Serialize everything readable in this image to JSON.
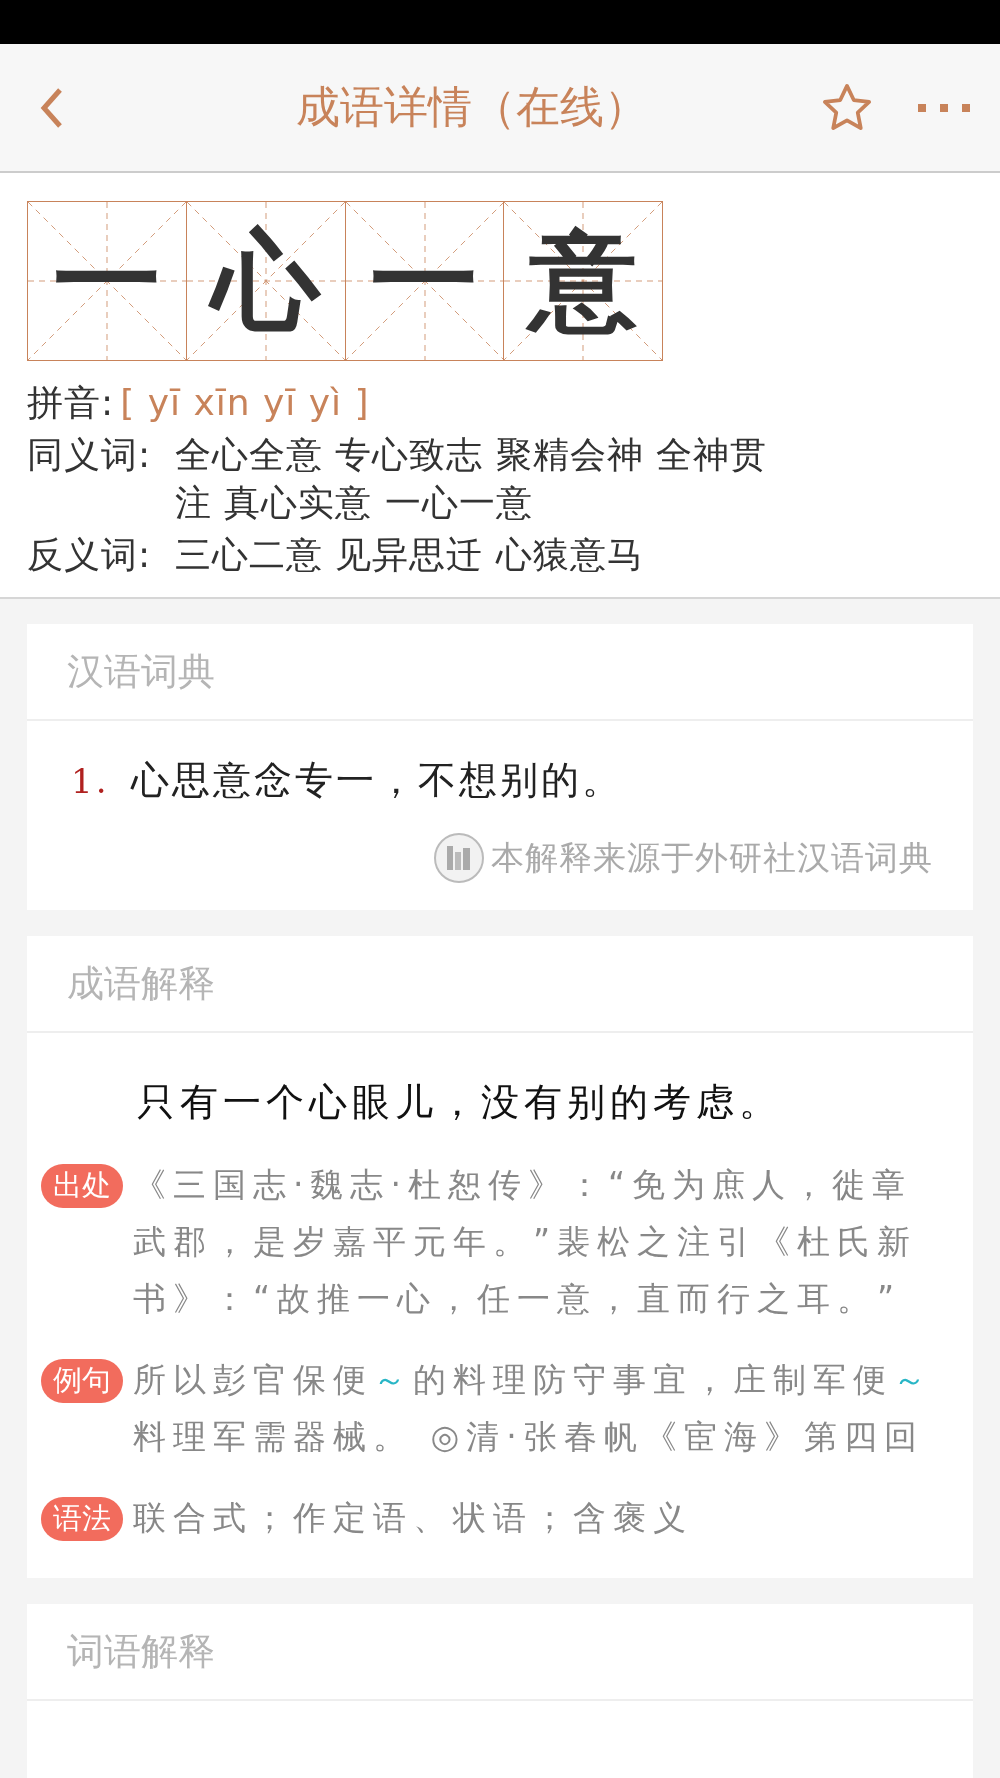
{
  "header": {
    "title": "成语详情（在线）",
    "favorited": false
  },
  "idiom": {
    "characters": [
      "一",
      "心",
      "一",
      "意"
    ],
    "pinyin": {
      "label": "拼音:",
      "value": "[ yī xīn yī yì ]"
    },
    "synonyms": {
      "label": "同义词:",
      "value": "全心全意 专心致志 聚精会神 全神贯注 真心实意 一心一意"
    },
    "antonyms": {
      "label": "反义词:",
      "value": "三心二意 见异思迁 心猿意马"
    }
  },
  "dictionary": {
    "title": "汉语词典",
    "items": [
      {
        "number": "1.",
        "text": "心思意念专一，不想别的。"
      }
    ],
    "source": "本解释来源于外研社汉语词典"
  },
  "explanation": {
    "title": "成语解释",
    "meaning": "只有一个心眼儿，没有别的考虑。",
    "entries": [
      {
        "tag": "出处",
        "segments": [
          {
            "kind": "text",
            "text": "《三国志·魏志·杜恕传》：“免为庶人，徙章武郡，是岁嘉平元年。”裴松之注引《杜氏新书》：“故推一心，任一意，直而行之耳。”"
          }
        ]
      },
      {
        "tag": "例句",
        "segments": [
          {
            "kind": "text",
            "text": "所以彭官保便"
          },
          {
            "kind": "swung_dash",
            "text": "～"
          },
          {
            "kind": "text",
            "text": "的料理防守事宜，庄制军便"
          },
          {
            "kind": "swung_dash",
            "text": "～"
          },
          {
            "kind": "text",
            "text": "料理军需器械。 ◎清·张春帆《宦海》第四回"
          }
        ]
      },
      {
        "tag": "语法",
        "segments": [
          {
            "kind": "text",
            "text": "联合式；作定语、状语；含褒义"
          }
        ]
      }
    ]
  },
  "word_explanation": {
    "title": "词语解释"
  }
}
